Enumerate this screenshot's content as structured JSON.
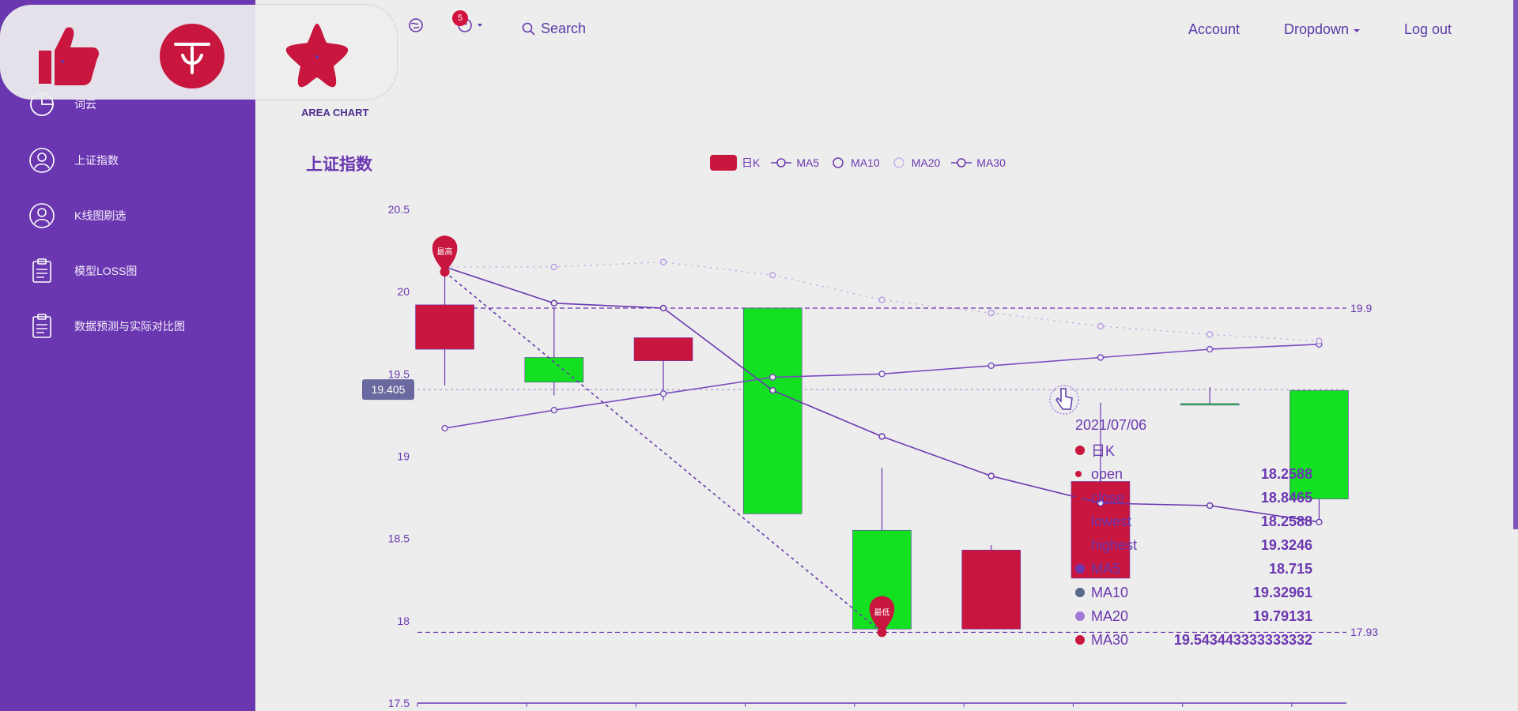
{
  "sidebar": {
    "items": [
      {
        "label": "词云",
        "icon": "pie-chart-icon"
      },
      {
        "label": "上证指数",
        "icon": "user-icon"
      },
      {
        "label": "K线图刷选",
        "icon": "user-icon"
      },
      {
        "label": "模型LOSS图",
        "icon": "clipboard-icon"
      },
      {
        "label": "数据预测与实际对比图",
        "icon": "clipboard-icon"
      }
    ]
  },
  "fab": {
    "buttons": [
      {
        "icon": "thumbs-up-icon"
      },
      {
        "icon": "circle-logo-icon"
      },
      {
        "icon": "star-icon"
      }
    ]
  },
  "topnav": {
    "badge_count": "5",
    "search_label": "Search",
    "account_label": "Account",
    "dropdown_label": "Dropdown",
    "logout_label": "Log out"
  },
  "page": {
    "breadcrumb": "AREA CHART",
    "chart_title": "上证指数"
  },
  "colors": {
    "primary": "#6a37b0",
    "up": "#c8163e",
    "down": "#13e021",
    "background": "#ededed"
  },
  "chart_data": {
    "type": "candlestick",
    "title": "上证指数",
    "legend": [
      "日K",
      "MA5",
      "MA10",
      "MA20",
      "MA30"
    ],
    "ylim": [
      17.5,
      20.5
    ],
    "yticks": [
      17.5,
      18,
      18.5,
      19,
      19.5,
      20,
      20.5
    ],
    "candles": [
      {
        "open": 19.65,
        "close": 19.92,
        "low": 19.43,
        "high": 20.15,
        "color": "up"
      },
      {
        "open": 19.6,
        "close": 19.45,
        "low": 19.37,
        "high": 19.9,
        "color": "down"
      },
      {
        "open": 19.72,
        "close": 19.58,
        "low": 19.34,
        "high": 19.72,
        "color": "up"
      },
      {
        "open": 19.9,
        "close": 18.65,
        "low": 18.65,
        "high": 19.9,
        "color": "down"
      },
      {
        "open": 18.55,
        "close": 17.95,
        "low": 17.93,
        "high": 18.93,
        "color": "down"
      },
      {
        "open": 18.43,
        "close": 17.95,
        "low": 17.95,
        "high": 18.46,
        "color": "up"
      },
      {
        "open": 18.2588,
        "close": 18.8465,
        "low": 18.2588,
        "high": 19.3246,
        "color": "up"
      },
      {
        "open": 19.32,
        "close": 19.32,
        "low": 19.32,
        "high": 19.42,
        "color": "down"
      },
      {
        "open": 19.4,
        "close": 18.74,
        "low": 18.6,
        "high": 19.4,
        "color": "down"
      }
    ],
    "series": [
      {
        "name": "MA5",
        "values": [
          20.15,
          19.93,
          19.9,
          19.4,
          19.12,
          18.88,
          18.715,
          18.7,
          18.6
        ]
      },
      {
        "name": "MA10",
        "values": [
          19.17,
          19.28,
          19.38,
          19.48,
          19.5,
          19.55,
          19.6,
          19.65,
          19.68
        ]
      },
      {
        "name": "MA20",
        "values": [
          20.15,
          20.15,
          20.18,
          20.1,
          19.95,
          19.87,
          19.79,
          19.74,
          19.7
        ]
      },
      {
        "name": "MA30",
        "values": [
          20.12,
          null,
          null,
          null,
          17.93,
          null,
          null,
          null,
          null
        ]
      }
    ],
    "markpoints": [
      {
        "label": "最高",
        "value": 20.12
      },
      {
        "label": "最低",
        "value": 17.93
      }
    ],
    "marklines": [
      {
        "value": "19.9"
      },
      {
        "value": "17.93"
      }
    ],
    "crosshair_value": "19.405",
    "tooltip": {
      "date": "2021/07/06",
      "series_label": "日K",
      "rows": [
        {
          "name": "open",
          "value": "18.2588"
        },
        {
          "name": "close",
          "value": "18.8465"
        },
        {
          "name": "lowest",
          "value": "18.2588"
        },
        {
          "name": "highest",
          "value": "19.3246"
        }
      ],
      "ma_rows": [
        {
          "name": "MA5",
          "value": "18.715",
          "color": "#6a37b0"
        },
        {
          "name": "MA10",
          "value": "19.32961",
          "color": "#5a6a8a"
        },
        {
          "name": "MA20",
          "value": "19.79131",
          "color": "#a478d8"
        },
        {
          "name": "MA30",
          "value": "19.543443333333332",
          "color": "#c8163e"
        }
      ]
    }
  }
}
